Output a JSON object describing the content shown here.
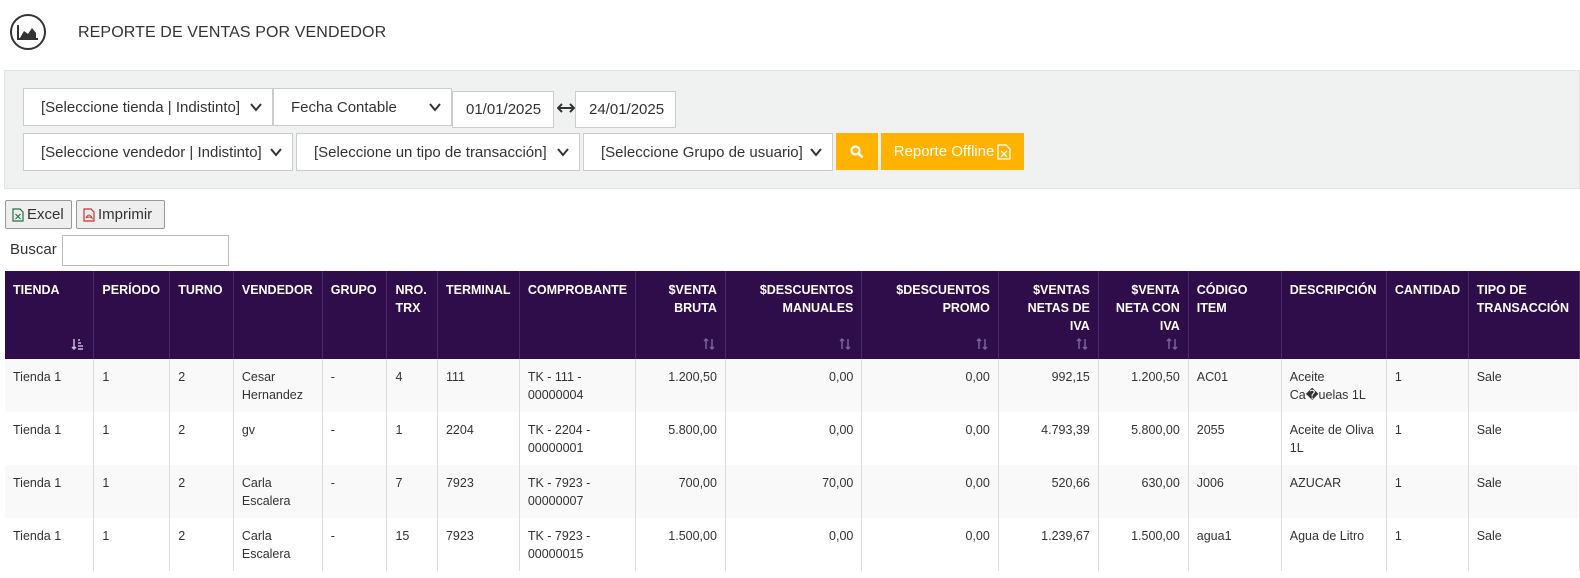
{
  "header": {
    "title": "REPORTE DE VENTAS POR VENDEDOR",
    "logo_icon": "area-chart-icon"
  },
  "filters": {
    "store": "[Seleccione tienda | Indistinto]",
    "date_type": "Fecha Contable",
    "date_from": "01/01/2025",
    "date_to": "24/01/2025",
    "seller": "[Seleccione vendedor | Indistinto]",
    "transaction_type": "[Seleccione un tipo de transacción]",
    "user_group": "[Seleccione Grupo de usuario]",
    "offline_label": "Reporte Offline",
    "accent": "#ffb300"
  },
  "toolbar": {
    "excel_label": "Excel",
    "print_label": "Imprimir",
    "search_label": "Buscar"
  },
  "table": {
    "header_bg": "#2e0d4a",
    "columns": [
      "TIENDA",
      "PERÍODO",
      "TURNO",
      "VENDEDOR",
      "GRUPO",
      "NRO. TRX",
      "TERMINAL",
      "COMPROBANTE",
      "$VENTA BRUTA",
      "$DESCUENTOS MANUALES",
      "$DESCUENTOS PROMO",
      "$VENTAS NETAS DE IVA",
      "$VENTA NETA CON IVA",
      "CÓDIGO ITEM",
      "DESCRIPCIÓN",
      "CANTIDAD",
      "TIPO DE TRANSACCIÓN"
    ],
    "rows": [
      [
        "Tienda 1",
        "1",
        "2",
        "Cesar Hernandez",
        "-",
        "4",
        "111",
        "TK - 111 - 00000004",
        "1.200,50",
        "0,00",
        "0,00",
        "992,15",
        "1.200,50",
        "AC01",
        "Aceite Ca�uelas 1L",
        "1",
        "Sale"
      ],
      [
        "Tienda 1",
        "1",
        "2",
        "gv",
        "-",
        "1",
        "2204",
        "TK - 2204 - 00000001",
        "5.800,00",
        "0,00",
        "0,00",
        "4.793,39",
        "5.800,00",
        "2055",
        "Aceite de Oliva 1L",
        "1",
        "Sale"
      ],
      [
        "Tienda 1",
        "1",
        "2",
        "Carla Escalera",
        "-",
        "7",
        "7923",
        "TK - 7923 - 00000007",
        "700,00",
        "70,00",
        "0,00",
        "520,66",
        "630,00",
        "J006",
        "AZUCAR",
        "1",
        "Sale"
      ],
      [
        "Tienda 1",
        "1",
        "2",
        "Carla Escalera",
        "-",
        "15",
        "7923",
        "TK - 7923 - 00000015",
        "1.500,00",
        "0,00",
        "0,00",
        "1.239,67",
        "1.500,00",
        "agua1",
        "Agua de Litro",
        "1",
        "Sale"
      ]
    ]
  }
}
